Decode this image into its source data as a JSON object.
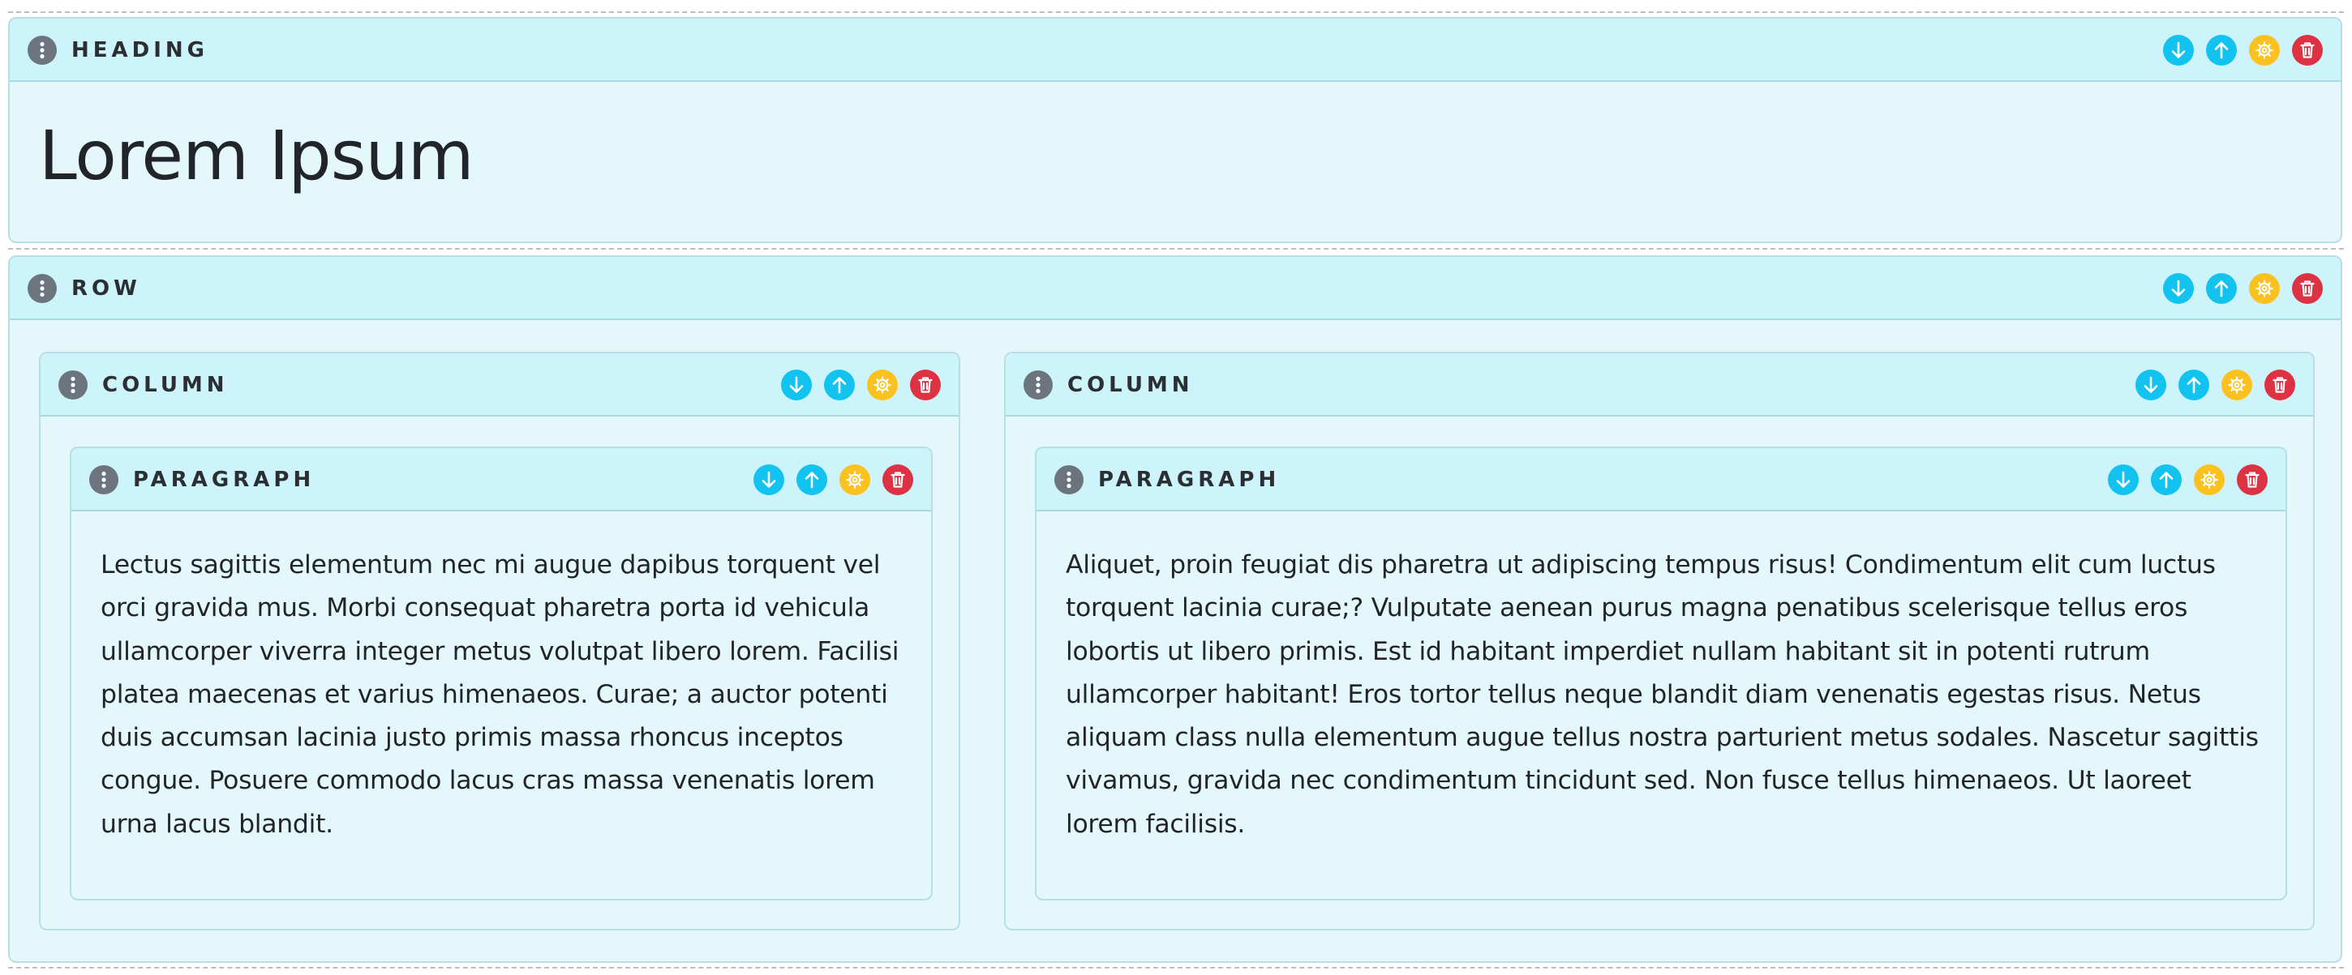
{
  "heading_block": {
    "label": "HEADING",
    "text": "Lorem Ipsum"
  },
  "row_block": {
    "label": "ROW",
    "columns": [
      {
        "label": "COLUMN",
        "paragraph": {
          "label": "PARAGRAPH",
          "text": "Lectus sagittis elementum nec mi augue dapibus torquent vel orci gravida mus. Morbi consequat pharetra porta id vehicula ullamcorper viverra integer metus volutpat libero lorem. Facilisi platea maecenas et varius himenaeos. Curae; a auctor potenti duis accumsan lacinia justo primis massa rhoncus inceptos congue. Posuere commodo lacus cras massa venenatis lorem urna lacus blandit."
        }
      },
      {
        "label": "COLUMN",
        "paragraph": {
          "label": "PARAGRAPH",
          "text": "Aliquet, proin feugiat dis pharetra ut adipiscing tempus risus! Condimentum elit cum luctus torquent lacinia curae;? Vulputate aenean purus magna penatibus scelerisque tellus eros lobortis ut libero primis. Est id habitant imperdiet nullam habitant sit in potenti rutrum ullamcorper habitant! Eros tortor tellus neque blandit diam venenatis egestas risus. Netus aliquam class nulla elementum augue tellus nostra parturient metus sodales. Nascetur sagittis vivamus, gravida nec condimentum tincidunt sed. Non fusce tellus himenaeos. Ut laoreet lorem facilisis."
        }
      }
    ]
  },
  "icons": {
    "drag_handle": "vertical-dots-icon",
    "move_down": "arrow-down-icon",
    "move_up": "arrow-up-icon",
    "settings": "gear-icon",
    "delete": "trash-icon"
  },
  "colors": {
    "block_background": "#e4f8fc",
    "header_background": "#cef4fb",
    "border": "#b9dde6",
    "handle": "#6c757d",
    "move_buttons": "#11c3ee",
    "settings_button": "#fbc21f",
    "delete_button": "#dd3144"
  }
}
